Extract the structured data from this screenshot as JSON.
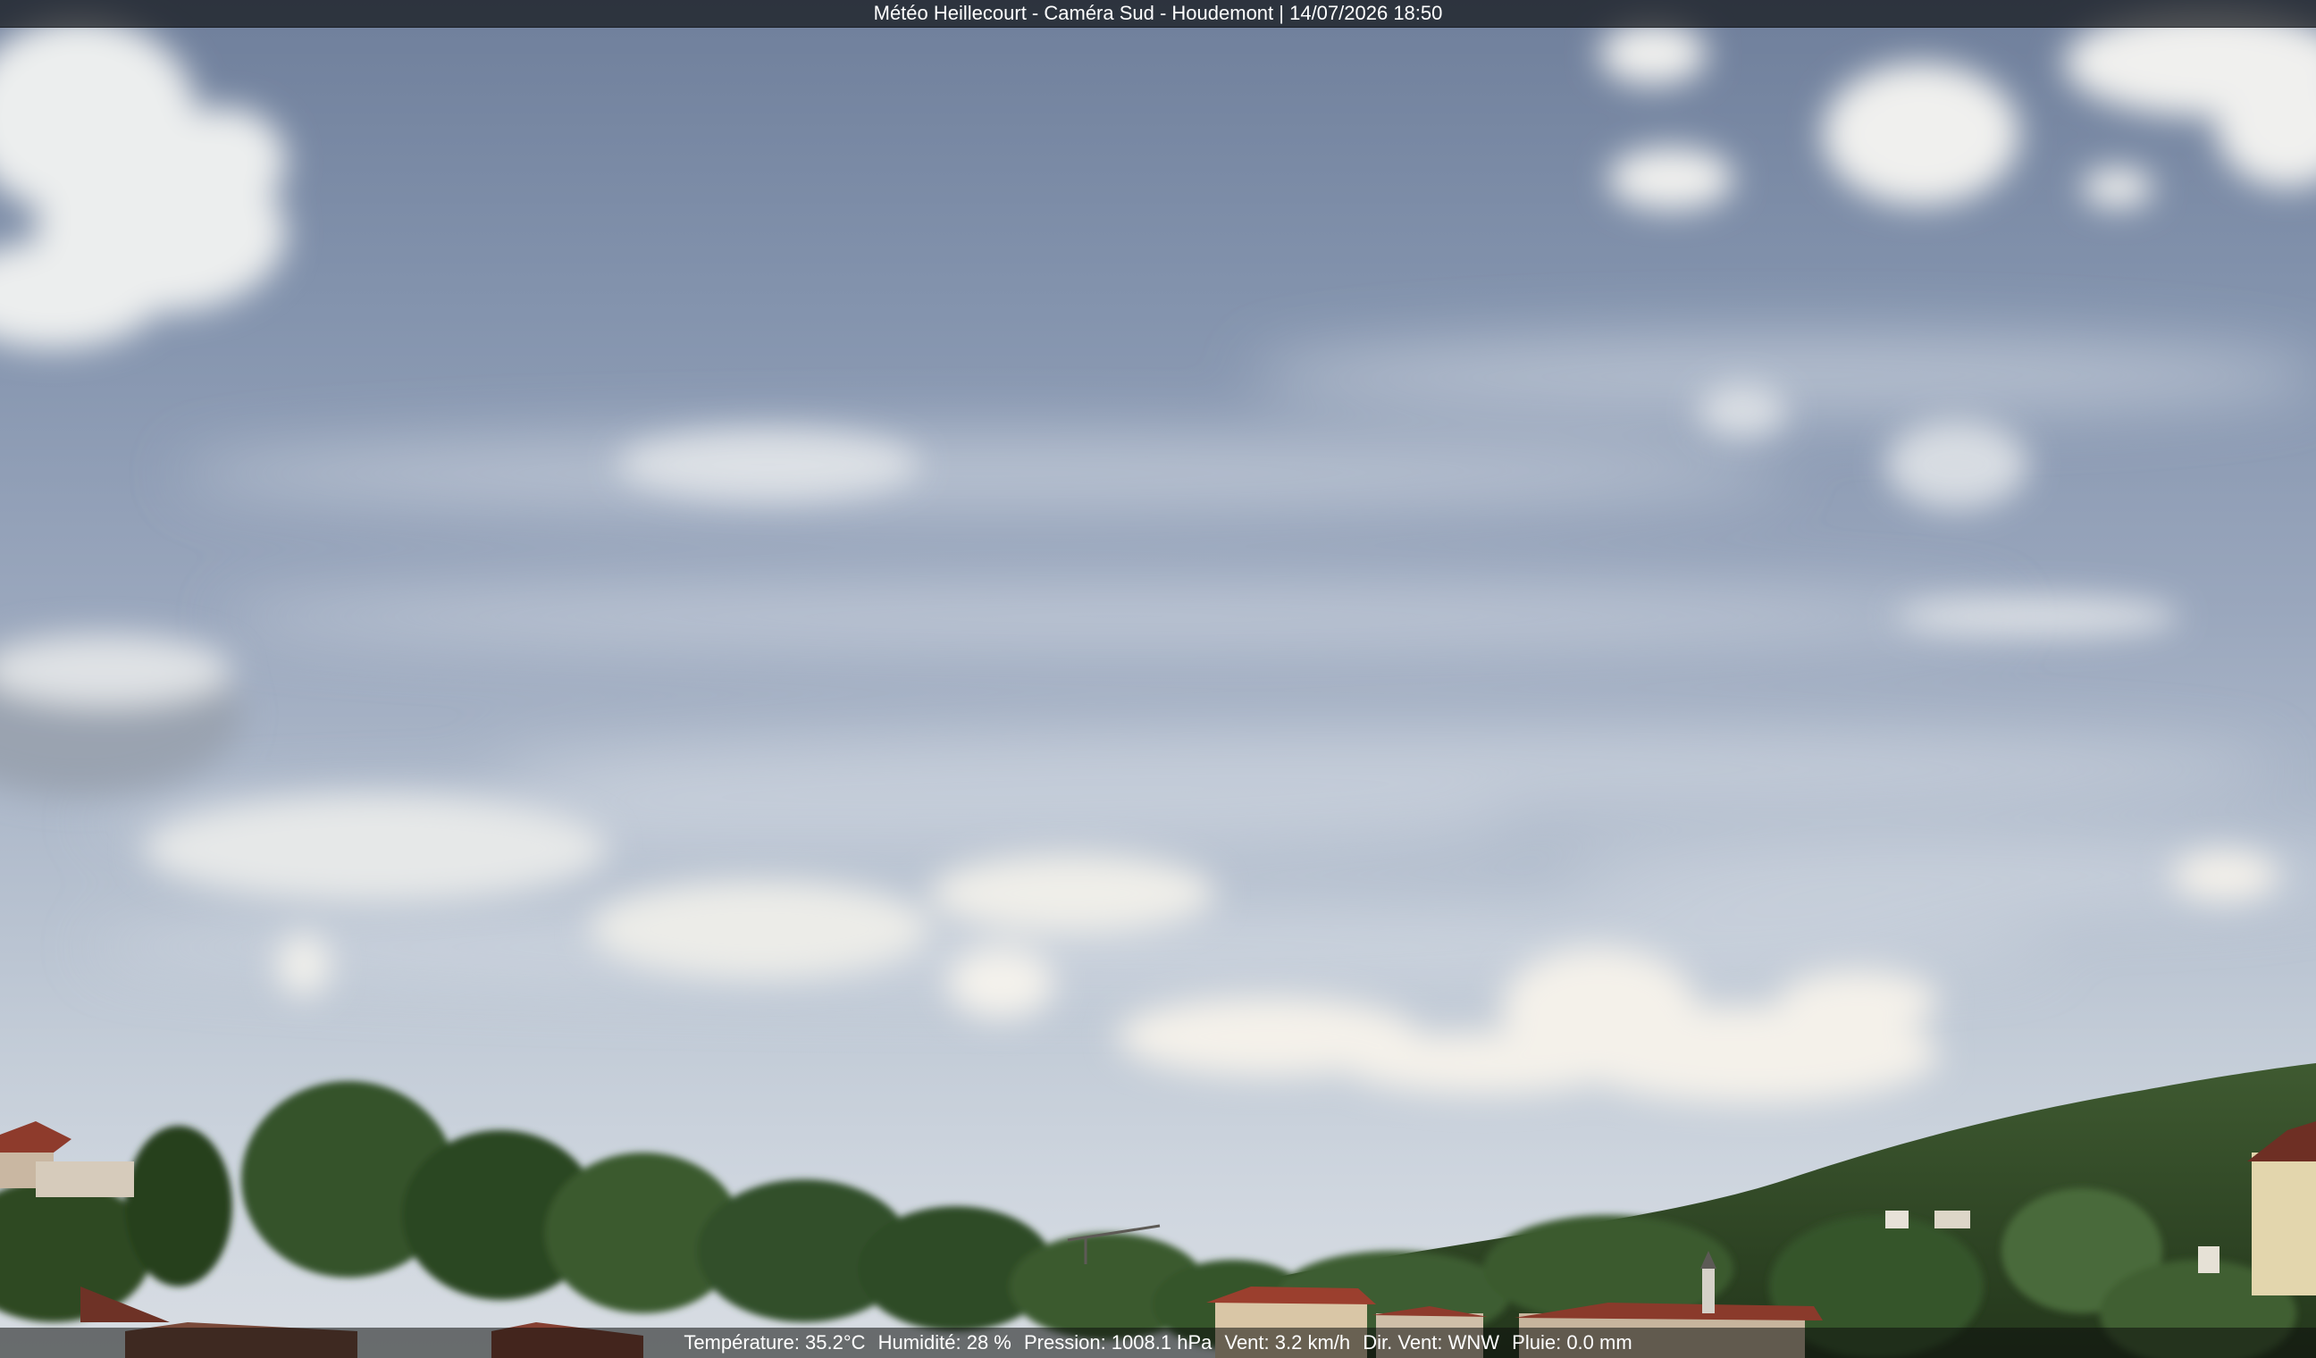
{
  "overlay": {
    "title": "Météo Heillecourt - Caméra Sud - Houdemont | 14/07/2026 18:50",
    "readings": [
      "Température: 35.2°C",
      "Humidité: 28 %",
      "Pression: 1008.1 hPa",
      "Vent: 3.2 km/h",
      "Dir. Vent: WNW",
      "Pluie: 0.0 mm"
    ]
  },
  "colors": {
    "sky_top": "#6f7f9b",
    "sky_bottom": "#d8dde3",
    "cloud": "#f2f2ee",
    "foliage": "#2f4f26",
    "roof": "#8e3b2c",
    "overlay_bar": "#14161a"
  }
}
